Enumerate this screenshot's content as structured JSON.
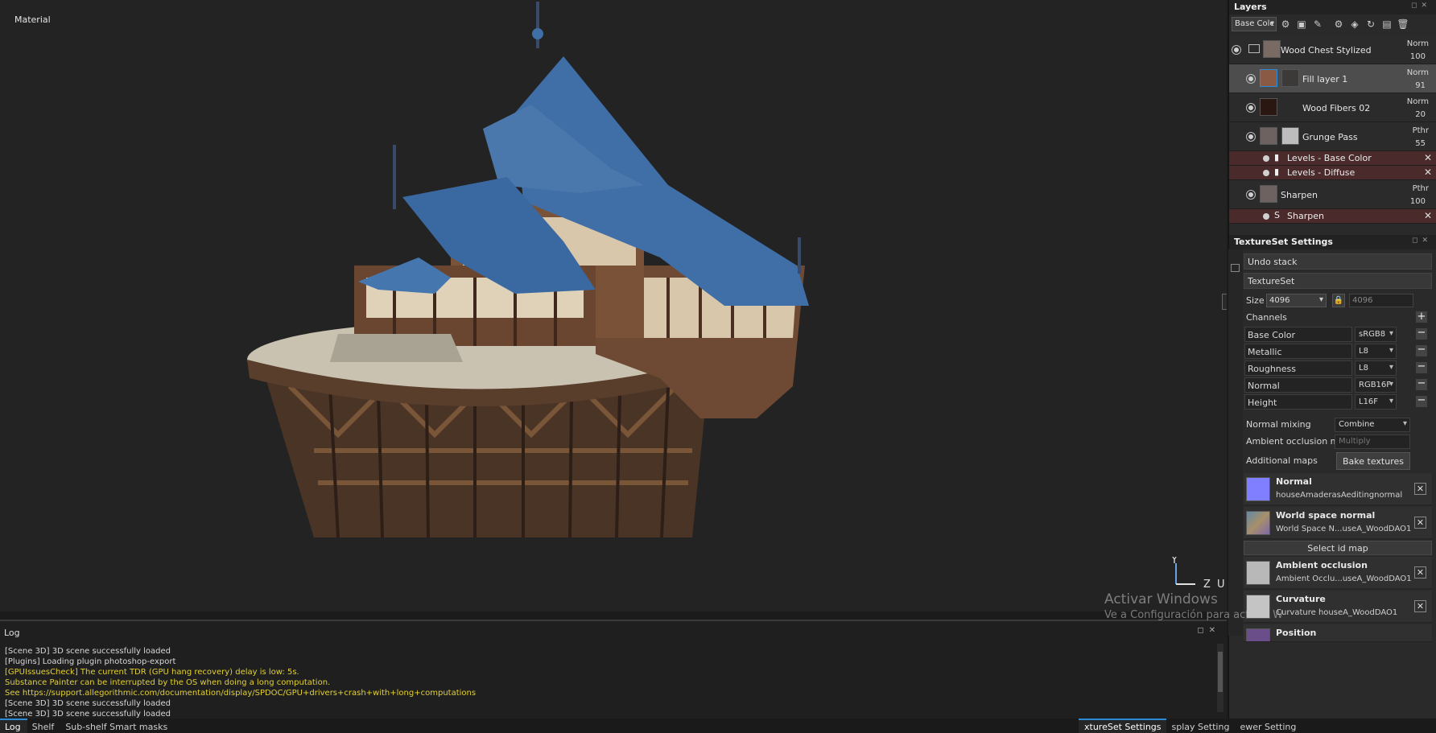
{
  "viewport": {
    "mode_label": "Material",
    "axis": {
      "y": "Y",
      "z": "Z",
      "u": "U"
    },
    "colors": {
      "roof": "#3f6fa6",
      "wood": "#6e4a34",
      "plaster": "#d8c7ab",
      "platform": "#c9c2b0"
    }
  },
  "log": {
    "title": "Log",
    "lines": [
      {
        "text": "[Scene 3D] 3D scene successfully loaded",
        "level": "info"
      },
      {
        "text": "[Plugins] Loading plugin photoshop-export",
        "level": "info"
      },
      {
        "text": "[GPUIssuesCheck] The current TDR (GPU hang recovery) delay is low: 5s.",
        "level": "warn"
      },
      {
        "text": "   Substance Painter can be interrupted by the OS when doing a long computation.",
        "level": "warn"
      },
      {
        "text": "   See https://support.allegorithmic.com/documentation/display/SPDOC/GPU+drivers+crash+with+long+computations",
        "level": "warn"
      },
      {
        "text": "[Scene 3D] 3D scene successfully loaded",
        "level": "info"
      },
      {
        "text": "[Scene 3D] 3D scene successfully loaded",
        "level": "info"
      }
    ]
  },
  "bottom_tabs": [
    "Log",
    "Shelf",
    "Sub-shelf Smart masks"
  ],
  "layers_panel": {
    "title": "Layers",
    "channel": "Base Colc",
    "layers": [
      {
        "name": "Wood Chest Stylized",
        "blend": "Norm",
        "opacity": "100",
        "kind": "folder"
      },
      {
        "name": "Fill layer 1",
        "blend": "Norm",
        "opacity": "91",
        "kind": "fill",
        "selected": true
      },
      {
        "name": "Wood Fibers 02",
        "blend": "Norm",
        "opacity": "20",
        "kind": "fill"
      },
      {
        "name": "Grunge Pass",
        "blend": "Pthr",
        "opacity": "55",
        "kind": "paint"
      }
    ],
    "effects_grunge": [
      {
        "name": "Levels - Base Color"
      },
      {
        "name": "Levels - Diffuse"
      }
    ],
    "sharpen_layer": {
      "name": "Sharpen",
      "blend": "Pthr",
      "opacity": "100"
    },
    "sharpen_effect": {
      "name": "Sharpen"
    }
  },
  "textureset": {
    "title": "TextureSet Settings",
    "undo_stack": "Undo stack",
    "textureset_label": "TextureSet",
    "size_label": "Size",
    "size_value": "4096",
    "size_value2": "4096",
    "channels_label": "Channels",
    "channels": [
      {
        "name": "Base Color",
        "format": "sRGB8"
      },
      {
        "name": "Metallic",
        "format": "L8"
      },
      {
        "name": "Roughness",
        "format": "L8"
      },
      {
        "name": "Normal",
        "format": "RGB16F"
      },
      {
        "name": "Height",
        "format": "L16F"
      }
    ],
    "normal_mixing_label": "Normal mixing",
    "normal_mixing_value": "Combine",
    "ao_mixing_label": "Ambient occlusion mixing",
    "ao_mixing_value": "Multiply",
    "additional_maps_label": "Additional maps",
    "bake_button": "Bake textures",
    "maps": [
      {
        "title": "Normal",
        "file": "houseAmaderasAeditingnormal",
        "swatch": "#7f7fff"
      },
      {
        "title": "World space normal",
        "file": "World Space N...useA_WoodDAO1",
        "swatch": "#8a7c9a"
      }
    ],
    "select_id_map": "Select id map",
    "maps2": [
      {
        "title": "Ambient occlusion",
        "file": "Ambient Occlu...useA_WoodDAO1",
        "swatch": "#b8b8b8"
      },
      {
        "title": "Curvature",
        "file": "Curvature houseA_WoodDAO1",
        "swatch": "#c4c4c4"
      },
      {
        "title": "Position",
        "file": "",
        "swatch": "#6a4e8a"
      }
    ]
  },
  "watermark": {
    "line1": "Activar Windows",
    "line2": "Ve a Configuración para activar W"
  },
  "right_tabs": [
    "xtureSet Settings",
    "splay Setting",
    "ewer Setting"
  ]
}
